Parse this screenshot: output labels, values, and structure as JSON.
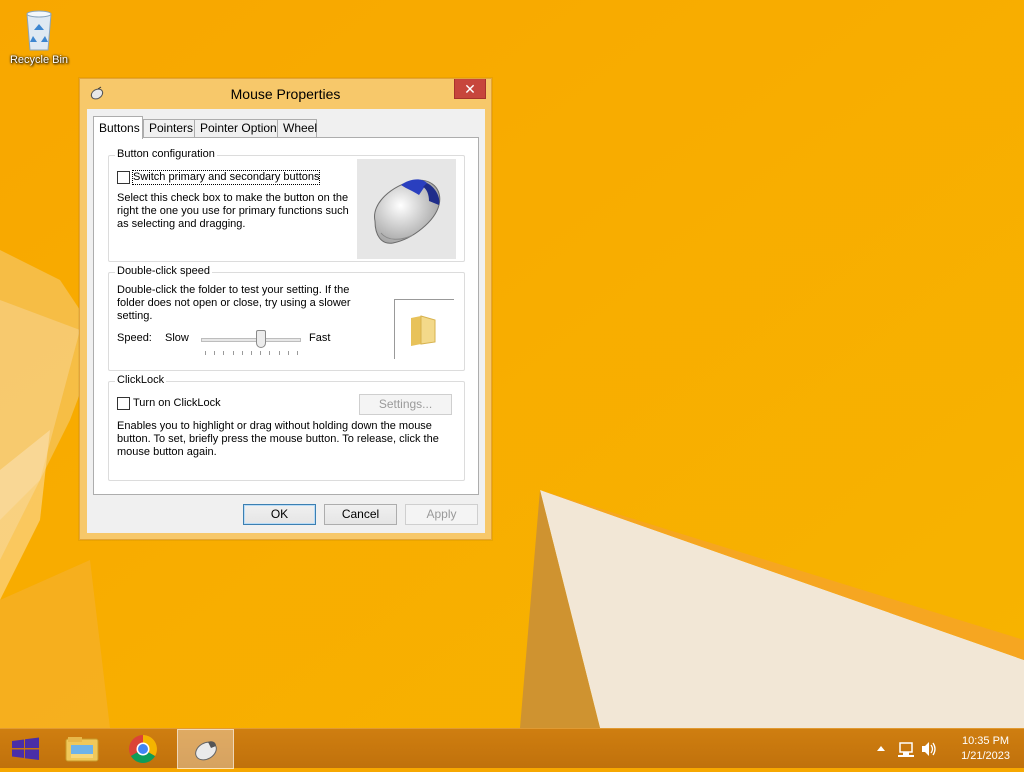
{
  "desktop": {
    "icons": [
      {
        "label": "Recycle Bin",
        "icon": "recycle-bin-icon"
      }
    ]
  },
  "window": {
    "title": "Mouse Properties",
    "close_label": "✕",
    "tabs": [
      {
        "label": "Buttons",
        "active": true
      },
      {
        "label": "Pointers",
        "active": false
      },
      {
        "label": "Pointer Options",
        "active": false
      },
      {
        "label": "Wheel",
        "active": false
      }
    ],
    "button_config": {
      "title": "Button configuration",
      "checkbox_label": "Switch primary and secondary buttons",
      "checked": false,
      "description": "Select this check box to make the button on the right the one you use for primary functions such as selecting and dragging."
    },
    "double_click": {
      "title": "Double-click speed",
      "description": "Double-click the folder to test your setting. If the folder does not open or close, try using a slower setting.",
      "speed_label": "Speed:",
      "slow_label": "Slow",
      "fast_label": "Fast",
      "speed_fraction": 0.6
    },
    "clicklock": {
      "title": "ClickLock",
      "checkbox_label": "Turn on ClickLock",
      "checked": false,
      "settings_button": "Settings...",
      "description": "Enables you to highlight or drag without holding down the mouse button. To set, briefly press the mouse button. To release, click the mouse button again."
    },
    "buttons": {
      "ok": "OK",
      "cancel": "Cancel",
      "apply": "Apply"
    }
  },
  "taskbar": {
    "items": [
      {
        "icon": "windows-start-icon"
      },
      {
        "icon": "file-explorer-icon"
      },
      {
        "icon": "chrome-icon"
      },
      {
        "icon": "mouse-properties-icon",
        "active": true
      }
    ],
    "tray": {
      "icons": [
        "show-hidden-icons-chevron",
        "network-icon",
        "volume-icon"
      ]
    },
    "clock": {
      "time": "10:35 PM",
      "date": "1/21/2023"
    }
  },
  "colors": {
    "wallpaper": "#f7a800",
    "taskbar": "#c9780e",
    "close_button": "#c7463c"
  }
}
